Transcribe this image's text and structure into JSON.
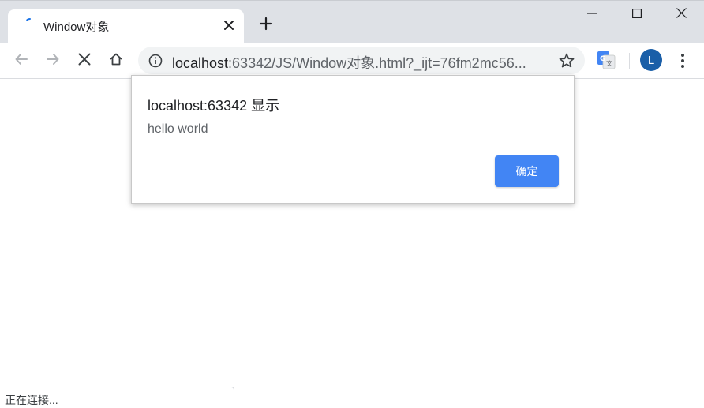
{
  "tab": {
    "title": "Window对象",
    "loading_icon": "loading-spinner-icon",
    "close_icon": "close-icon"
  },
  "newtab": {
    "icon": "plus-icon"
  },
  "window_controls": {
    "minimize_icon": "minimize-icon",
    "maximize_icon": "maximize-icon",
    "close_icon": "close-icon"
  },
  "toolbar": {
    "back_icon": "arrow-left-icon",
    "forward_icon": "arrow-right-icon",
    "stop_icon": "stop-x-icon",
    "home_icon": "home-icon",
    "url_host": "localhost",
    "url_rest": ":63342/JS/Window对象.html?_ijt=76fm2mc56...",
    "site_info_icon": "info-icon",
    "bookmark_icon": "star-icon",
    "translate_icon": "google-translate-icon",
    "avatar_letter": "L",
    "menu_icon": "three-dot-menu-icon"
  },
  "dialog": {
    "title": "localhost:63342 显示",
    "message": "hello world",
    "ok_label": "确定"
  },
  "status": {
    "text": "正在连接..."
  },
  "colors": {
    "tabstrip": "#dee1e6",
    "omnibox": "#f1f3f4",
    "accent_button": "#4285f4",
    "avatar": "#1a5fa8"
  }
}
